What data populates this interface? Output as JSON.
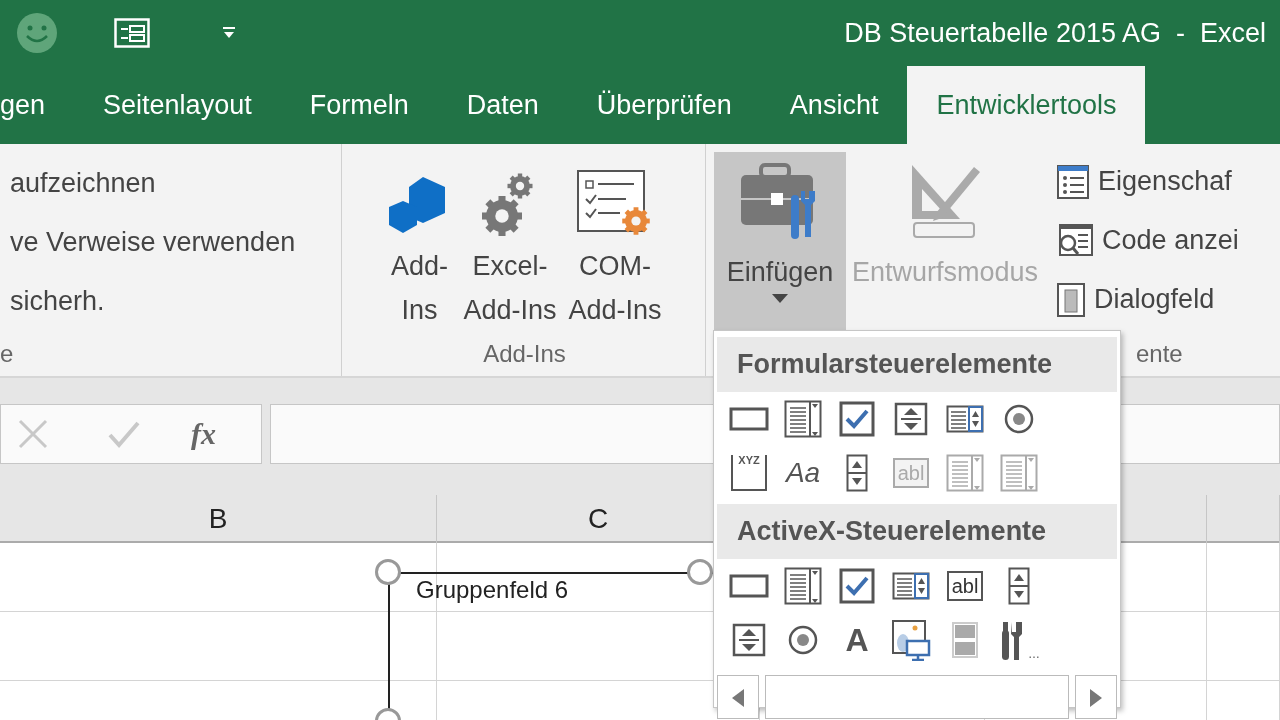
{
  "window": {
    "title": "DB Steuertabelle 2015 AG  -  Excel"
  },
  "tabs": [
    {
      "label": "gen",
      "selected": false
    },
    {
      "label": "Seitenlayout",
      "selected": false
    },
    {
      "label": "Formeln",
      "selected": false
    },
    {
      "label": "Daten",
      "selected": false
    },
    {
      "label": "Überprüfen",
      "selected": false
    },
    {
      "label": "Ansicht",
      "selected": false
    },
    {
      "label": "Entwicklertools",
      "selected": true
    }
  ],
  "ribbon": {
    "code_group": {
      "items": [
        "aufzeichnen",
        "ve Verweise verwenden",
        "sicherh."
      ],
      "label": "e"
    },
    "addins_group": {
      "label": "Add-Ins",
      "buttons": [
        {
          "kind": "addins",
          "lines": [
            "Add-",
            "Ins"
          ]
        },
        {
          "kind": "excel-addins",
          "lines": [
            "Excel-",
            "Add-Ins"
          ]
        },
        {
          "kind": "com-addins",
          "lines": [
            "COM-",
            "Add-Ins"
          ]
        }
      ]
    },
    "controls_group": {
      "label": "ente",
      "large": [
        {
          "kind": "insert",
          "label": "Einfügen",
          "pressed": true,
          "disabled": false
        },
        {
          "kind": "design",
          "label": "Entwurfsmodus",
          "pressed": false,
          "disabled": true
        }
      ],
      "small": [
        {
          "kind": "properties",
          "label": "Eigenschaf"
        },
        {
          "kind": "code",
          "label": "Code anzei"
        },
        {
          "kind": "dialog",
          "label": "Dialogfeld"
        }
      ]
    }
  },
  "formula_bar": {
    "function_label": "fx"
  },
  "columns": [
    "B",
    "C"
  ],
  "shape": {
    "label": "Gruppenfeld 6",
    "selected": true
  },
  "insert_menu": {
    "sections": [
      {
        "title": "Formularsteuerelemente",
        "items": [
          {
            "kind": "button",
            "disabled": false
          },
          {
            "kind": "combo",
            "disabled": false
          },
          {
            "kind": "checkbox",
            "disabled": false
          },
          {
            "kind": "spinner",
            "disabled": false
          },
          {
            "kind": "listbox",
            "disabled": false
          },
          {
            "kind": "option",
            "disabled": false
          },
          {
            "kind": "groupbox",
            "glyph": "XYZ",
            "disabled": false
          },
          {
            "kind": "label",
            "glyph": "Aa",
            "disabled": false
          },
          {
            "kind": "scrollbar",
            "disabled": false
          },
          {
            "kind": "textfield",
            "glyph": "abl",
            "disabled": true
          },
          {
            "kind": "combo",
            "disabled": true
          },
          {
            "kind": "combo",
            "disabled": true
          }
        ]
      },
      {
        "title": "ActiveX-Steuerelemente",
        "items": [
          {
            "kind": "button",
            "disabled": false
          },
          {
            "kind": "combo",
            "disabled": false
          },
          {
            "kind": "checkbox",
            "disabled": false
          },
          {
            "kind": "listbox",
            "disabled": false
          },
          {
            "kind": "textfield",
            "glyph": "abl",
            "disabled": false
          },
          {
            "kind": "scrollbar",
            "disabled": false
          },
          {
            "kind": "spinner",
            "disabled": false
          },
          {
            "kind": "option",
            "disabled": false
          },
          {
            "kind": "label",
            "glyph": "A",
            "disabled": false
          },
          {
            "kind": "image",
            "disabled": false
          },
          {
            "kind": "toggle",
            "disabled": false
          },
          {
            "kind": "more",
            "glyph": "…",
            "disabled": false
          }
        ]
      }
    ]
  }
}
